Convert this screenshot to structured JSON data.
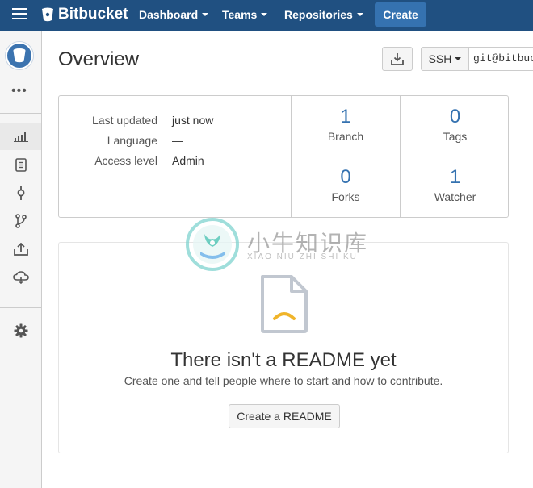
{
  "topbar": {
    "brand": "Bitbucket",
    "nav": [
      {
        "label": "Dashboard"
      },
      {
        "label": "Teams"
      },
      {
        "label": "Repositories"
      }
    ],
    "create_label": "Create"
  },
  "sidebar": {
    "more_label": "•••",
    "items": [
      {
        "icon": "overview-icon",
        "active": true
      },
      {
        "icon": "source-icon"
      },
      {
        "icon": "commits-icon"
      },
      {
        "icon": "branches-icon"
      },
      {
        "icon": "pull-requests-icon"
      },
      {
        "icon": "downloads-cloud-icon"
      },
      {
        "icon": "settings-gear-icon"
      }
    ]
  },
  "header": {
    "title": "Overview",
    "ssh_label": "SSH",
    "clone_url": "git@bitbucket.org:"
  },
  "repo_info": {
    "meta": [
      {
        "label": "Last updated",
        "value": "just now"
      },
      {
        "label": "Language",
        "value": "—"
      },
      {
        "label": "Access level",
        "value": "Admin"
      }
    ],
    "stats": [
      {
        "value": "1",
        "label": "Branch"
      },
      {
        "value": "0",
        "label": "Tags"
      },
      {
        "value": "0",
        "label": "Forks"
      },
      {
        "value": "1",
        "label": "Watcher"
      }
    ]
  },
  "readme": {
    "title": "There isn't a README yet",
    "subtitle": "Create one and tell people where to start and how to contribute.",
    "button_label": "Create a README"
  },
  "watermark": {
    "cn": "小牛知识库",
    "en": "XIAO NIU ZHI SHI KU"
  },
  "colors": {
    "topbar": "#205081",
    "accent": "#3572b0",
    "readme_face": "#f0b429"
  }
}
